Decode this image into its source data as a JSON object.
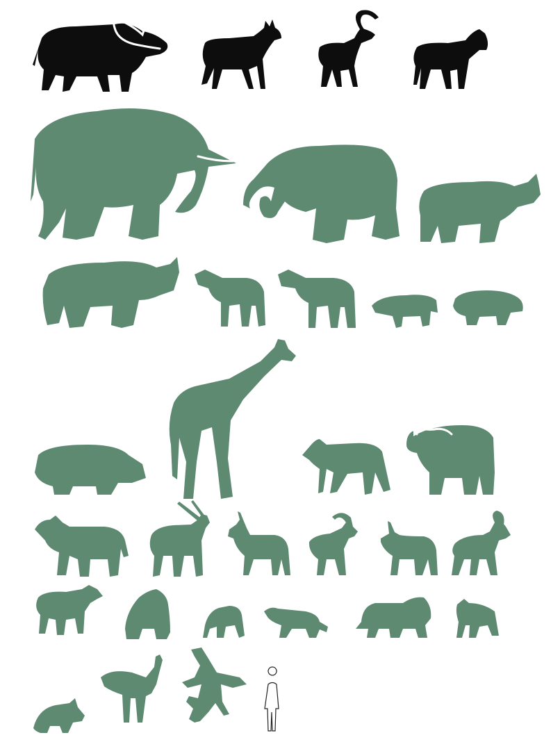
{
  "colors": {
    "silhouette_green": "#5e8a72",
    "silhouette_black": "#0d0d0d",
    "background": "#ffffff",
    "human_outline": "#222222"
  },
  "rows": [
    {
      "style": "black",
      "animals": [
        "cape-buffalo",
        "hartebeest",
        "ibex",
        "zebra"
      ]
    },
    {
      "style": "green",
      "animals": [
        "african-bush-elephant",
        "african-forest-elephant",
        "black-rhinoceros"
      ]
    },
    {
      "style": "green",
      "animals": [
        "white-rhinoceros",
        "plains-zebra",
        "grevys-zebra",
        "warthog",
        "pygmy-hippopotamus"
      ]
    },
    {
      "style": "green",
      "animals": [
        "hippopotamus",
        "giraffe",
        "okapi",
        "african-buffalo"
      ]
    },
    {
      "style": "green",
      "animals": [
        "eland",
        "oryx",
        "impala",
        "kudu",
        "nyala",
        "sable-antelope"
      ]
    },
    {
      "style": "green",
      "animals": [
        "wildebeest",
        "gorilla",
        "chimpanzee",
        "leopard",
        "lion",
        "hyena"
      ]
    },
    {
      "style": "green",
      "animals": [
        "aardvark",
        "ostrich",
        "crocodile",
        "human-scale-figure"
      ]
    }
  ]
}
